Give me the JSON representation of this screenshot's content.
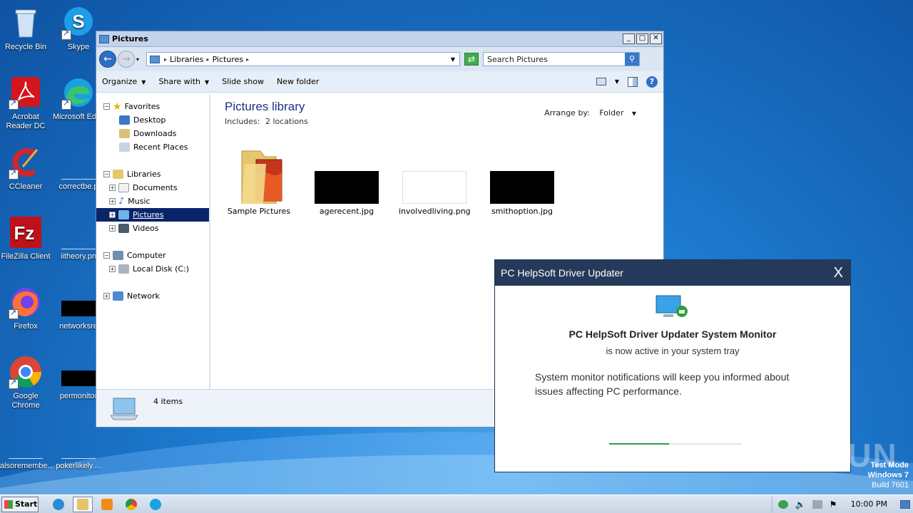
{
  "desktop": {
    "icons": [
      {
        "label": "Recycle Bin"
      },
      {
        "label": "Skype"
      },
      {
        "label": "Acrobat Reader DC"
      },
      {
        "label": "Microsoft Edge"
      },
      {
        "label": "CCleaner"
      },
      {
        "label": "correctbe.p"
      },
      {
        "label": "FileZilla Client"
      },
      {
        "label": "iitheory.pn"
      },
      {
        "label": "Firefox"
      },
      {
        "label": "networksre"
      },
      {
        "label": "Google Chrome"
      },
      {
        "label": "permonitor"
      },
      {
        "label": "alsoremembe..."
      },
      {
        "label": "pokerlikely...."
      }
    ]
  },
  "explorer": {
    "title": "Pictures",
    "address": [
      "Libraries",
      "Pictures"
    ],
    "search_placeholder": "Search Pictures",
    "commands": [
      "Organize",
      "Share with",
      "Slide show",
      "New folder"
    ],
    "nav": {
      "favorites": "Favorites",
      "desktop": "Desktop",
      "downloads": "Downloads",
      "recent": "Recent Places",
      "libraries": "Libraries",
      "documents": "Documents",
      "music": "Music",
      "pictures": "Pictures",
      "videos": "Videos",
      "computer": "Computer",
      "localdisk": "Local Disk (C:)",
      "network": "Network"
    },
    "library_title": "Pictures library",
    "includes_label": "Includes:",
    "includes_link": "2 locations",
    "arrange_label": "Arrange by:",
    "arrange_value": "Folder",
    "files": [
      {
        "name": "Sample Pictures"
      },
      {
        "name": "agerecent.jpg"
      },
      {
        "name": "involvedliving.png"
      },
      {
        "name": "smithoption.jpg"
      }
    ],
    "status": "4 items"
  },
  "popup": {
    "title": "PC HelpSoft Driver Updater",
    "close": "X",
    "headline": "PC HelpSoft Driver Updater System Monitor",
    "subline": "is now active in your system tray",
    "body": "System monitor notifications will keep you informed about issues affecting PC performance.",
    "progress": 0.45
  },
  "watermark": "ANY RUN",
  "system": {
    "test_mode": "Test Mode",
    "os": "Windows 7",
    "build": "Build 7601"
  },
  "taskbar": {
    "start": "Start",
    "clock": "10:00 PM"
  }
}
